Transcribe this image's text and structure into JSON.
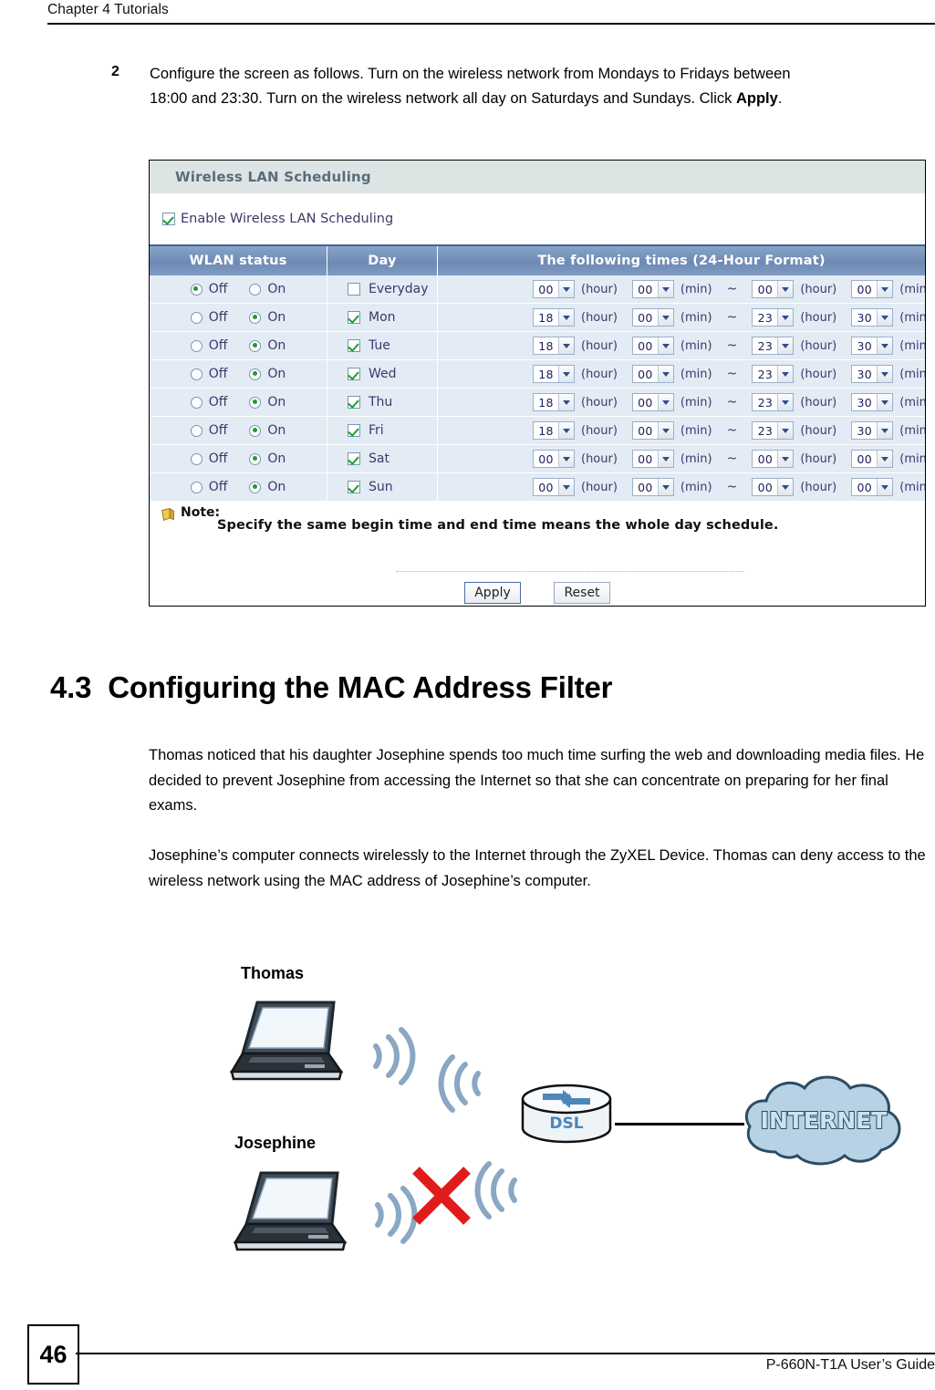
{
  "header": {
    "chapter": "Chapter 4 Tutorials"
  },
  "step": {
    "number": "2",
    "text_before_bold": "Configure the screen as follows. Turn on the wireless network from Mondays to Fridays between 18:00 and 23:30. Turn on the wireless network all day on Saturdays and Sundays. Click ",
    "bold_word": "Apply",
    "text_after_bold": "."
  },
  "screenshot": {
    "panel_title": "Wireless LAN Scheduling",
    "enable_checkbox_label": "Enable Wireless LAN Scheduling",
    "enable_checked": true,
    "table_headers": {
      "status": "WLAN status",
      "day": "Day",
      "times": "The following times   (24-Hour Format)"
    },
    "labels": {
      "off": "Off",
      "on": "On",
      "hour": "(hour)",
      "min": "(min)",
      "tilde": "~"
    },
    "rows": [
      {
        "day": "Everyday",
        "day_checked": false,
        "status": "off",
        "begin_hour": "00",
        "begin_min": "00",
        "end_hour": "00",
        "end_min": "00"
      },
      {
        "day": "Mon",
        "day_checked": true,
        "status": "on",
        "begin_hour": "18",
        "begin_min": "00",
        "end_hour": "23",
        "end_min": "30"
      },
      {
        "day": "Tue",
        "day_checked": true,
        "status": "on",
        "begin_hour": "18",
        "begin_min": "00",
        "end_hour": "23",
        "end_min": "30"
      },
      {
        "day": "Wed",
        "day_checked": true,
        "status": "on",
        "begin_hour": "18",
        "begin_min": "00",
        "end_hour": "23",
        "end_min": "30"
      },
      {
        "day": "Thu",
        "day_checked": true,
        "status": "on",
        "begin_hour": "18",
        "begin_min": "00",
        "end_hour": "23",
        "end_min": "30"
      },
      {
        "day": "Fri",
        "day_checked": true,
        "status": "on",
        "begin_hour": "18",
        "begin_min": "00",
        "end_hour": "23",
        "end_min": "30"
      },
      {
        "day": "Sat",
        "day_checked": true,
        "status": "on",
        "begin_hour": "00",
        "begin_min": "00",
        "end_hour": "00",
        "end_min": "00"
      },
      {
        "day": "Sun",
        "day_checked": true,
        "status": "on",
        "begin_hour": "00",
        "begin_min": "00",
        "end_hour": "00",
        "end_min": "00"
      }
    ],
    "note_label": "Note:",
    "note_text": "Specify the same begin time and end time means the whole day schedule.",
    "apply_button": "Apply",
    "reset_button": "Reset"
  },
  "section": {
    "number": "4.3",
    "title": "Configuring the MAC Address Filter",
    "paragraph1": "Thomas noticed that his daughter Josephine spends too much time surfing the web and downloading media files. He decided to prevent Josephine from accessing the Internet so that she can concentrate on preparing for her final exams.",
    "paragraph2": "Josephine’s computer connects wirelessly to the Internet through the ZyXEL Device. Thomas can deny access to the wireless network using the MAC address of Josephine’s computer."
  },
  "diagram": {
    "thomas_label": "Thomas",
    "josephine_label": "Josephine",
    "router_label": "DSL",
    "internet_label": "INTERNET",
    "colors": {
      "blocked": "#e01b1b",
      "wifi": "#8aa7c4",
      "cloud": "#b7d2e4"
    }
  },
  "footer": {
    "page_number": "46",
    "guide_title": "P-660N-T1A User’s Guide"
  }
}
